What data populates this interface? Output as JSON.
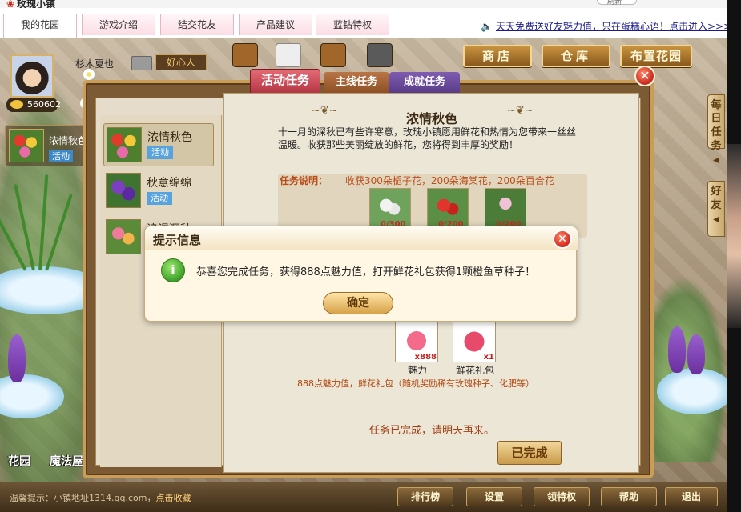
{
  "site": {
    "title": "玫瑰小镇",
    "top_pill": "刷新"
  },
  "nav": {
    "tabs": [
      "我的花园",
      "游戏介绍",
      "结交花友",
      "产品建议",
      "蓝钻特权"
    ],
    "marquee_text": "天天免费送好友魅力值，只在蛋糕心语！点击进入>>>"
  },
  "scene_buttons": {
    "shop": "商店",
    "warehouse": "仓库",
    "decorate": "布置花园"
  },
  "profile": {
    "name": "杉木夏也",
    "signature": "好心人",
    "coins": "560602"
  },
  "outside_activity": {
    "name": "浓情秋色",
    "tag": "活动"
  },
  "panel": {
    "tabs": {
      "activity": "活动任务",
      "main": "主线任务",
      "achievement": "成就任务"
    },
    "list": [
      {
        "name": "浓情秋色",
        "tag": "活动"
      },
      {
        "name": "秋意绵绵",
        "tag": "活动"
      },
      {
        "name": "浪漫深秋",
        "tag": ""
      }
    ],
    "detail": {
      "title": "浓情秋色",
      "description": "十一月的深秋已有些许寒意，玫瑰小镇愿用鲜花和热情为您带来一丝丝温暖。收获那些美丽绽放的鲜花，您将得到丰厚的奖励！",
      "task_label": "任务说明：",
      "task_text": "收获300朵栀子花，200朵海棠花，200朵百合花",
      "req_counts": [
        "0/300",
        "0/200",
        "0/200"
      ],
      "rewards": [
        {
          "label": "魅力",
          "badge": "x888"
        },
        {
          "label": "鲜花礼包",
          "badge": "x1"
        }
      ],
      "reward_desc": "888点魅力值，鲜花礼包（随机奖励稀有玫瑰种子、化肥等）",
      "done_text": "任务已完成，请明天再来。",
      "done_button": "已完成"
    }
  },
  "modal": {
    "title": "提示信息",
    "message": "恭喜您完成任务，获得888点魅力值，打开鲜花礼包获得1颗橙鱼草种子！",
    "ok": "确定"
  },
  "side_tabs": {
    "daily": "每日任务",
    "friends": "好友"
  },
  "bottom_labels": {
    "garden": "花园",
    "magic": "魔法屋"
  },
  "bottom": {
    "tip_prefix": "温馨提示：小镇地址1314.qq.com，",
    "tip_link": "点击收藏",
    "buttons": [
      "排行榜",
      "设置",
      "领特权",
      "帮助",
      "退出"
    ]
  },
  "colors": {
    "accent_pink": "#e56b74",
    "panel_brown": "#7c5a33",
    "gold": "#c99d55"
  }
}
